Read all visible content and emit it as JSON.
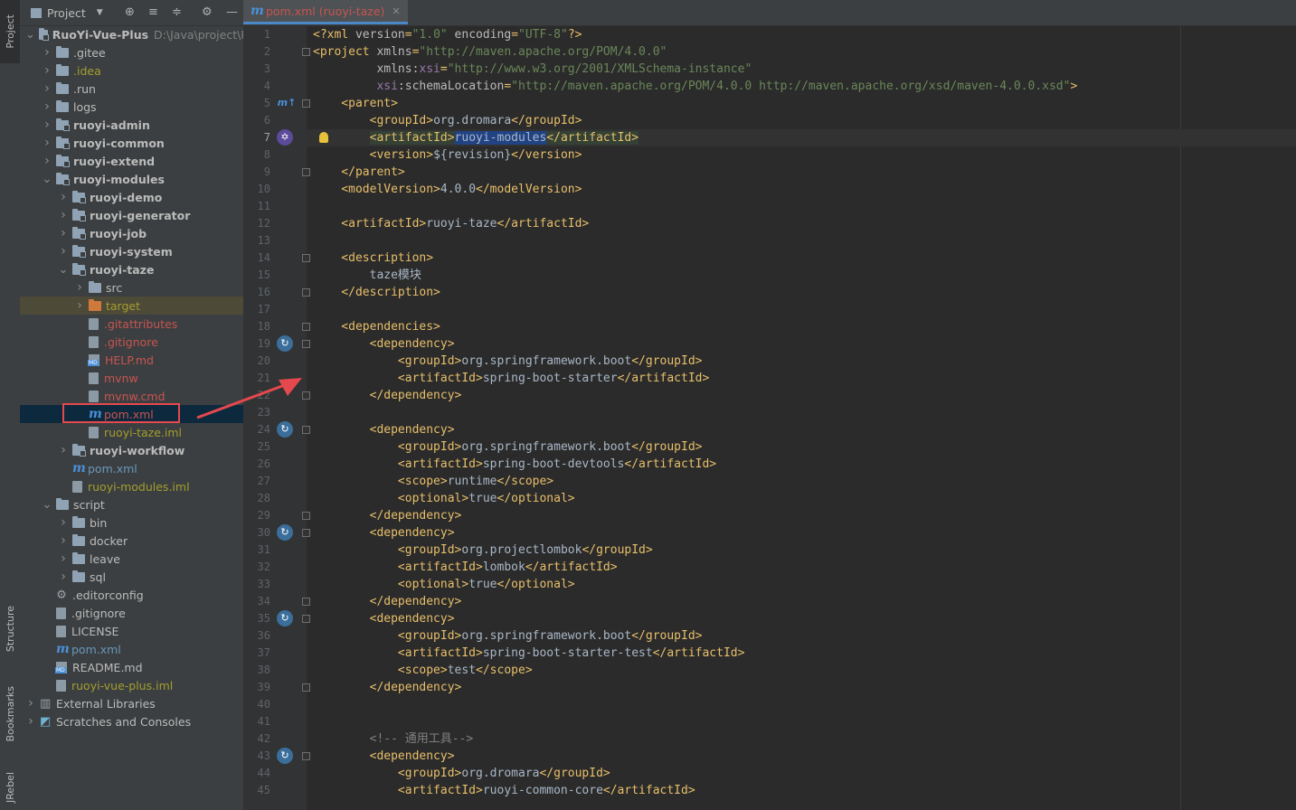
{
  "tool_strip": {
    "project": "Project",
    "structure": "Structure",
    "bookmarks": "Bookmarks",
    "jrebel": "JRebel"
  },
  "project_panel": {
    "title": "Project",
    "tree": [
      {
        "label": "RuoYi-Vue-Plus",
        "path": "D:\\Java\\project\\R",
        "depth": 0,
        "expanded": true,
        "kind": "module",
        "bold": true
      },
      {
        "label": ".gitee",
        "depth": 1,
        "kind": "folder"
      },
      {
        "label": ".idea",
        "depth": 1,
        "kind": "folder",
        "color": "olive"
      },
      {
        "label": ".run",
        "depth": 1,
        "kind": "folder"
      },
      {
        "label": "logs",
        "depth": 1,
        "kind": "folder"
      },
      {
        "label": "ruoyi-admin",
        "depth": 1,
        "kind": "module",
        "bold": true
      },
      {
        "label": "ruoyi-common",
        "depth": 1,
        "kind": "module",
        "bold": true
      },
      {
        "label": "ruoyi-extend",
        "depth": 1,
        "kind": "module",
        "bold": true
      },
      {
        "label": "ruoyi-modules",
        "depth": 1,
        "kind": "module",
        "bold": true,
        "expanded": true
      },
      {
        "label": "ruoyi-demo",
        "depth": 2,
        "kind": "module",
        "bold": true
      },
      {
        "label": "ruoyi-generator",
        "depth": 2,
        "kind": "module",
        "bold": true
      },
      {
        "label": "ruoyi-job",
        "depth": 2,
        "kind": "module",
        "bold": true
      },
      {
        "label": "ruoyi-system",
        "depth": 2,
        "kind": "module",
        "bold": true
      },
      {
        "label": "ruoyi-taze",
        "depth": 2,
        "kind": "module",
        "bold": true,
        "expanded": true
      },
      {
        "label": "src",
        "depth": 3,
        "kind": "folder"
      },
      {
        "label": "target",
        "depth": 3,
        "kind": "folder-orange",
        "color": "olive"
      },
      {
        "label": ".gitattributes",
        "depth": 3,
        "kind": "file",
        "color": "red",
        "noarrow": true
      },
      {
        "label": ".gitignore",
        "depth": 3,
        "kind": "file",
        "color": "red",
        "noarrow": true
      },
      {
        "label": "HELP.md",
        "depth": 3,
        "kind": "md",
        "color": "red",
        "noarrow": true
      },
      {
        "label": "mvnw",
        "depth": 3,
        "kind": "file",
        "color": "red",
        "noarrow": true
      },
      {
        "label": "mvnw.cmd",
        "depth": 3,
        "kind": "file",
        "color": "red",
        "noarrow": true
      },
      {
        "label": "pom.xml",
        "depth": 3,
        "kind": "maven",
        "color": "red",
        "noarrow": true,
        "selected": true
      },
      {
        "label": "ruoyi-taze.iml",
        "depth": 3,
        "kind": "file",
        "color": "olive",
        "noarrow": true
      },
      {
        "label": "ruoyi-workflow",
        "depth": 2,
        "kind": "module",
        "bold": true
      },
      {
        "label": "pom.xml",
        "depth": 2,
        "kind": "maven",
        "color": "blue",
        "noarrow": true
      },
      {
        "label": "ruoyi-modules.iml",
        "depth": 2,
        "kind": "file",
        "color": "olive",
        "noarrow": true
      },
      {
        "label": "script",
        "depth": 1,
        "kind": "folder",
        "expanded": true
      },
      {
        "label": "bin",
        "depth": 2,
        "kind": "folder"
      },
      {
        "label": "docker",
        "depth": 2,
        "kind": "folder"
      },
      {
        "label": "leave",
        "depth": 2,
        "kind": "folder"
      },
      {
        "label": "sql",
        "depth": 2,
        "kind": "folder"
      },
      {
        "label": ".editorconfig",
        "depth": 1,
        "kind": "gear",
        "noarrow": true
      },
      {
        "label": ".gitignore",
        "depth": 1,
        "kind": "file",
        "noarrow": true
      },
      {
        "label": "LICENSE",
        "depth": 1,
        "kind": "file",
        "noarrow": true
      },
      {
        "label": "pom.xml",
        "depth": 1,
        "kind": "maven",
        "color": "blue",
        "noarrow": true
      },
      {
        "label": "README.md",
        "depth": 1,
        "kind": "md",
        "noarrow": true
      },
      {
        "label": "ruoyi-vue-plus.iml",
        "depth": 1,
        "kind": "file",
        "color": "olive",
        "noarrow": true
      },
      {
        "label": "External Libraries",
        "depth": 0,
        "kind": "lib"
      },
      {
        "label": "Scratches and Consoles",
        "depth": 0,
        "kind": "scratch"
      }
    ]
  },
  "editor": {
    "tab_label": "pom.xml (ruoyi-taze)",
    "current_line": 7,
    "lines": [
      [
        [
          "t",
          "<?xml "
        ],
        [
          "a",
          "version"
        ],
        [
          "t",
          "="
        ],
        [
          "v",
          "\"1.0\""
        ],
        [
          "a",
          " encoding"
        ],
        [
          "t",
          "="
        ],
        [
          "v",
          "\"UTF-8\""
        ],
        [
          "t",
          "?>"
        ]
      ],
      [
        [
          "t",
          "<project "
        ],
        [
          "a",
          "xmlns"
        ],
        [
          "t",
          "="
        ],
        [
          "v",
          "\"http://maven.apache.org/POM/4.0.0\""
        ]
      ],
      [
        [
          "a",
          "         xmlns:"
        ],
        [
          "n",
          "xsi"
        ],
        [
          "t",
          "="
        ],
        [
          "v",
          "\"http://www.w3.org/2001/XMLSchema-instance\""
        ]
      ],
      [
        [
          "n",
          "         xsi"
        ],
        [
          "a",
          ":schemaLocation"
        ],
        [
          "t",
          "="
        ],
        [
          "v",
          "\"http://maven.apache.org/POM/4.0.0 http://maven.apache.org/xsd/maven-4.0.0.xsd\""
        ],
        [
          "t",
          ">"
        ]
      ],
      [
        [
          "t",
          "    <parent>"
        ]
      ],
      [
        [
          "t",
          "        <groupId>"
        ],
        [
          "p",
          "org.dromara"
        ],
        [
          "t",
          "</groupId>"
        ]
      ],
      [
        [
          "p",
          "        "
        ],
        [
          "th",
          "<artifactId>"
        ],
        [
          "s",
          "ruoyi-modules"
        ],
        [
          "th",
          "</artifactId>"
        ]
      ],
      [
        [
          "t",
          "        <version>"
        ],
        [
          "p",
          "${revision}"
        ],
        [
          "t",
          "</version>"
        ]
      ],
      [
        [
          "t",
          "    </parent>"
        ]
      ],
      [
        [
          "t",
          "    <modelVersion>"
        ],
        [
          "p",
          "4.0.0"
        ],
        [
          "t",
          "</modelVersion>"
        ]
      ],
      [],
      [
        [
          "t",
          "    <artifactId>"
        ],
        [
          "p",
          "ruoyi-taze"
        ],
        [
          "t",
          "</artifactId>"
        ]
      ],
      [],
      [
        [
          "t",
          "    <description>"
        ]
      ],
      [
        [
          "p",
          "        taze模块"
        ]
      ],
      [
        [
          "t",
          "    </description>"
        ]
      ],
      [],
      [
        [
          "t",
          "    <dependencies>"
        ]
      ],
      [
        [
          "t",
          "        <dependency>"
        ]
      ],
      [
        [
          "t",
          "            <groupId>"
        ],
        [
          "p",
          "org.springframework.boot"
        ],
        [
          "t",
          "</groupId>"
        ]
      ],
      [
        [
          "t",
          "            <artifactId>"
        ],
        [
          "p",
          "spring-boot-starter"
        ],
        [
          "t",
          "</artifactId>"
        ]
      ],
      [
        [
          "t",
          "        </dependency>"
        ]
      ],
      [],
      [
        [
          "t",
          "        <dependency>"
        ]
      ],
      [
        [
          "t",
          "            <groupId>"
        ],
        [
          "p",
          "org.springframework.boot"
        ],
        [
          "t",
          "</groupId>"
        ]
      ],
      [
        [
          "t",
          "            <artifactId>"
        ],
        [
          "p",
          "spring-boot-devtools"
        ],
        [
          "t",
          "</artifactId>"
        ]
      ],
      [
        [
          "t",
          "            <scope>"
        ],
        [
          "p",
          "runtime"
        ],
        [
          "t",
          "</scope>"
        ]
      ],
      [
        [
          "t",
          "            <optional>"
        ],
        [
          "p",
          "true"
        ],
        [
          "t",
          "</optional>"
        ]
      ],
      [
        [
          "t",
          "        </dependency>"
        ]
      ],
      [
        [
          "t",
          "        <dependency>"
        ]
      ],
      [
        [
          "t",
          "            <groupId>"
        ],
        [
          "p",
          "org.projectlombok"
        ],
        [
          "t",
          "</groupId>"
        ]
      ],
      [
        [
          "t",
          "            <artifactId>"
        ],
        [
          "p",
          "lombok"
        ],
        [
          "t",
          "</artifactId>"
        ]
      ],
      [
        [
          "t",
          "            <optional>"
        ],
        [
          "p",
          "true"
        ],
        [
          "t",
          "</optional>"
        ]
      ],
      [
        [
          "t",
          "        </dependency>"
        ]
      ],
      [
        [
          "t",
          "        <dependency>"
        ]
      ],
      [
        [
          "t",
          "            <groupId>"
        ],
        [
          "p",
          "org.springframework.boot"
        ],
        [
          "t",
          "</groupId>"
        ]
      ],
      [
        [
          "t",
          "            <artifactId>"
        ],
        [
          "p",
          "spring-boot-starter-test"
        ],
        [
          "t",
          "</artifactId>"
        ]
      ],
      [
        [
          "t",
          "            <scope>"
        ],
        [
          "p",
          "test"
        ],
        [
          "t",
          "</scope>"
        ]
      ],
      [
        [
          "t",
          "        </dependency>"
        ]
      ],
      [],
      [],
      [
        [
          "c",
          "        <!-- 通用工具-->"
        ]
      ],
      [
        [
          "t",
          "        <dependency>"
        ]
      ],
      [
        [
          "t",
          "            <groupId>"
        ],
        [
          "p",
          "org.dromara"
        ],
        [
          "t",
          "</groupId>"
        ]
      ],
      [
        [
          "t",
          "            <artifactId>"
        ],
        [
          "p",
          "ruoyi-common-core"
        ],
        [
          "t",
          "</artifactId>"
        ]
      ]
    ],
    "gutter_icons": {
      "5": "maven-parent-icon",
      "7": "artifact-icon",
      "19": "dependency-icon",
      "24": "dependency-icon",
      "30": "dependency-icon",
      "35": "dependency-icon",
      "43": "dependency-icon"
    },
    "fold_lines": [
      2,
      5,
      9,
      14,
      16,
      18,
      19,
      22,
      24,
      29,
      30,
      34,
      35,
      39,
      43
    ]
  },
  "colors": {
    "accent": "#4a88c7",
    "annotation": "#e5484d"
  }
}
